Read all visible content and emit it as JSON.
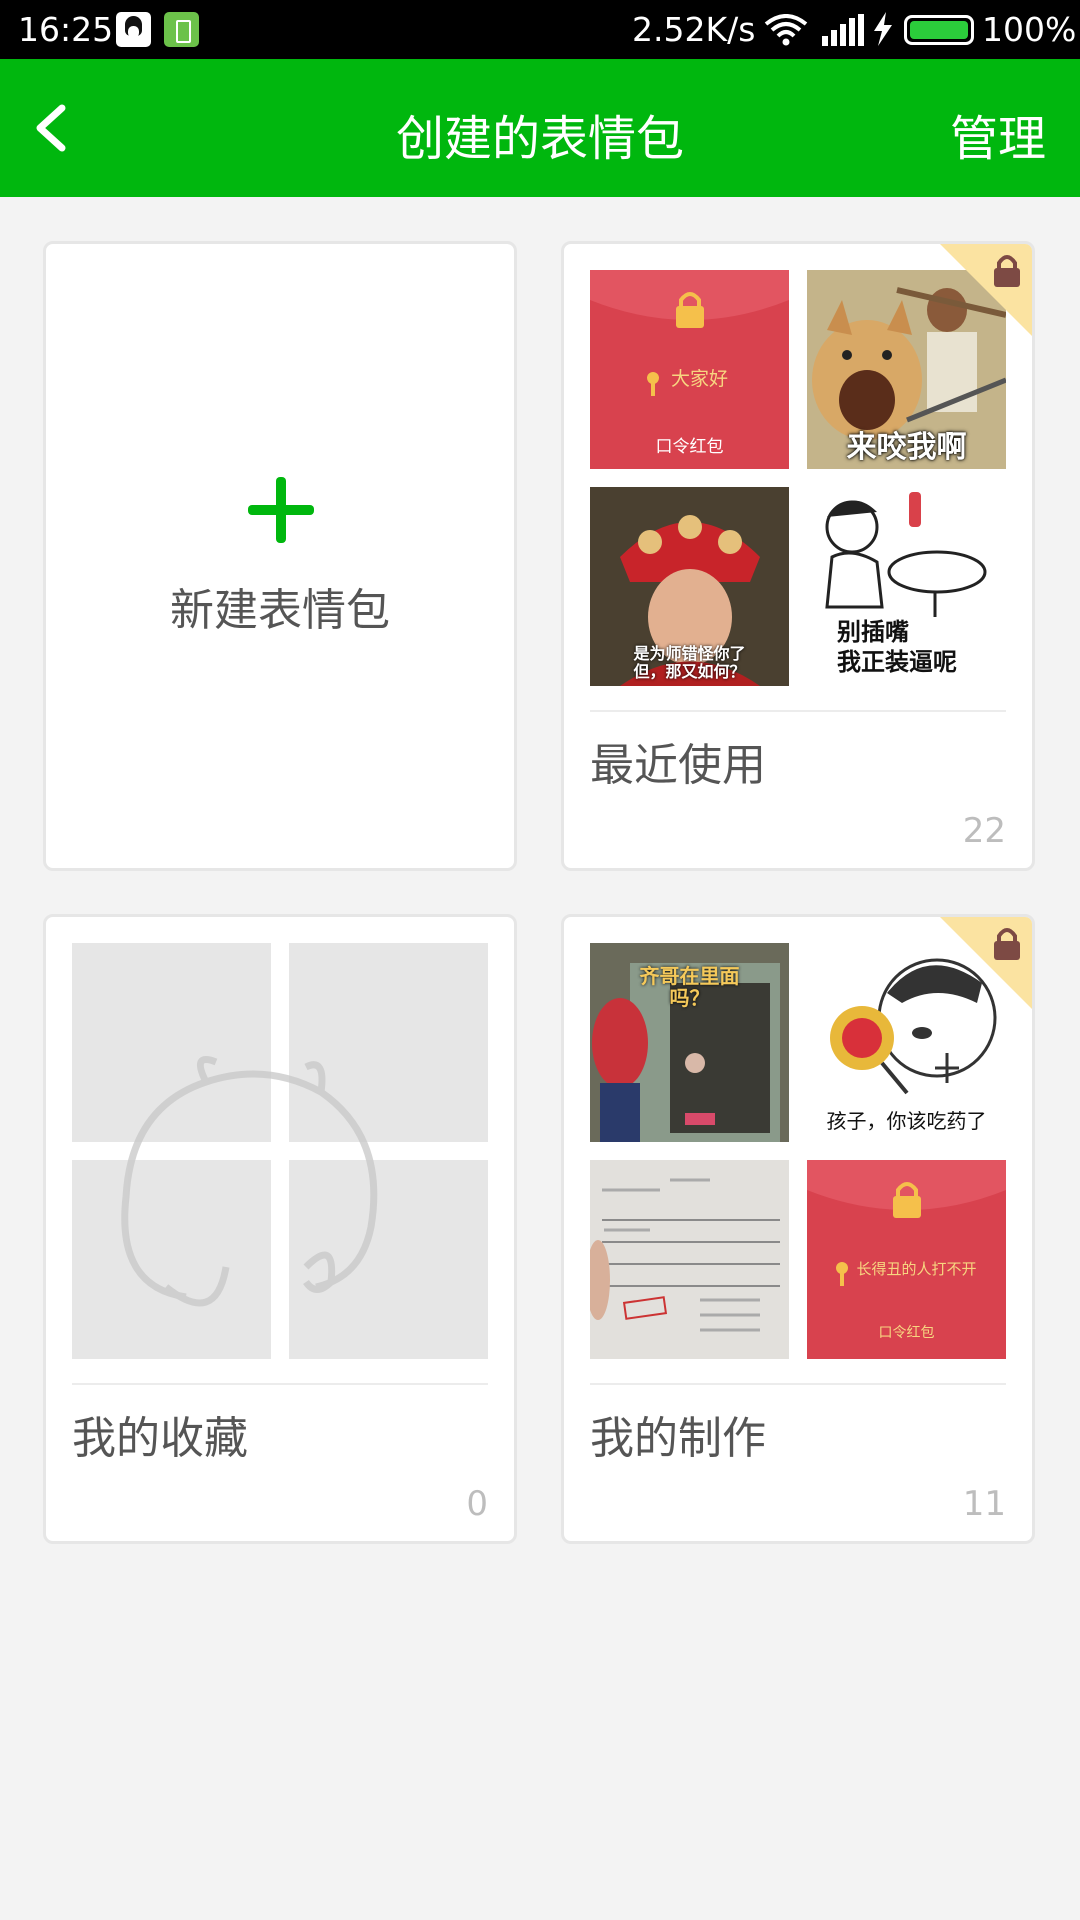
{
  "status_bar": {
    "time": "16:25",
    "speed": "2.52K/s",
    "battery": "100%"
  },
  "header": {
    "title": "创建的表情包",
    "manage_label": "管理",
    "back_icon": "chevron-left-icon"
  },
  "cards": {
    "new_pack": {
      "label": "新建表情包"
    },
    "recent": {
      "name": "最近使用",
      "count": "22",
      "thumbs": [
        {
          "kind": "red-envelope",
          "text": "大家好",
          "sub": "口令红包"
        },
        {
          "kind": "meme",
          "text": "来咬我啊"
        },
        {
          "kind": "meme",
          "text": "是为师错怪你了\n但，那又如何？"
        },
        {
          "kind": "meme",
          "text": "别插嘴\n我正装逼呢"
        }
      ]
    },
    "favorites": {
      "name": "我的收藏",
      "count": "0"
    },
    "mine": {
      "name": "我的制作",
      "count": "11",
      "thumbs": [
        {
          "kind": "meme",
          "text": "齐哥在里面\n吗？"
        },
        {
          "kind": "meme",
          "text": "孩子，你该吃药了"
        },
        {
          "kind": "document",
          "text": ""
        },
        {
          "kind": "red-envelope",
          "text": "长得丑的人打不开",
          "sub": "口令红包"
        }
      ]
    }
  },
  "colors": {
    "brand_green": "#00b70e",
    "envelope_red": "#d8424e",
    "lock_badge": "#fbe3a1"
  }
}
